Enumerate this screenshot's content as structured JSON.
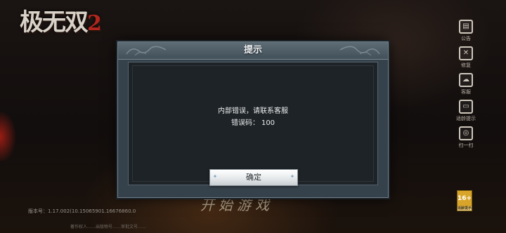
{
  "game": {
    "logo_text": "极无双",
    "logo_number": "2",
    "start_text": "开始游戏",
    "version_text": "版本号：1.17.002(10.15065901.16676860.0",
    "footer_text": "著作权人……出版物号……审批文号……"
  },
  "side_menu": {
    "items": [
      {
        "icon": "scroll-icon",
        "glyph": "▤",
        "label": "公告"
      },
      {
        "icon": "tools-icon",
        "glyph": "✕",
        "label": "修复"
      },
      {
        "icon": "cloud-icon",
        "glyph": "☁",
        "label": "客服"
      },
      {
        "icon": "monitor-icon",
        "glyph": "▭",
        "label": "适龄提示"
      },
      {
        "icon": "swirl-icon",
        "glyph": "◎",
        "label": "扫一扫"
      }
    ]
  },
  "age_badge": {
    "value": "16+",
    "caption": "适龄提示"
  },
  "dialog": {
    "title": "提示",
    "message_line1": "内部错误，请联系客服",
    "error_label": "错误码：",
    "error_code": "100",
    "confirm_label": "确定"
  },
  "colors": {
    "dialog_frame": "#36424b",
    "dialog_header": "#5d6c75",
    "dialog_body": "#1e2327",
    "button_face": "#e6e9eb",
    "accent_red": "#b3261e"
  }
}
